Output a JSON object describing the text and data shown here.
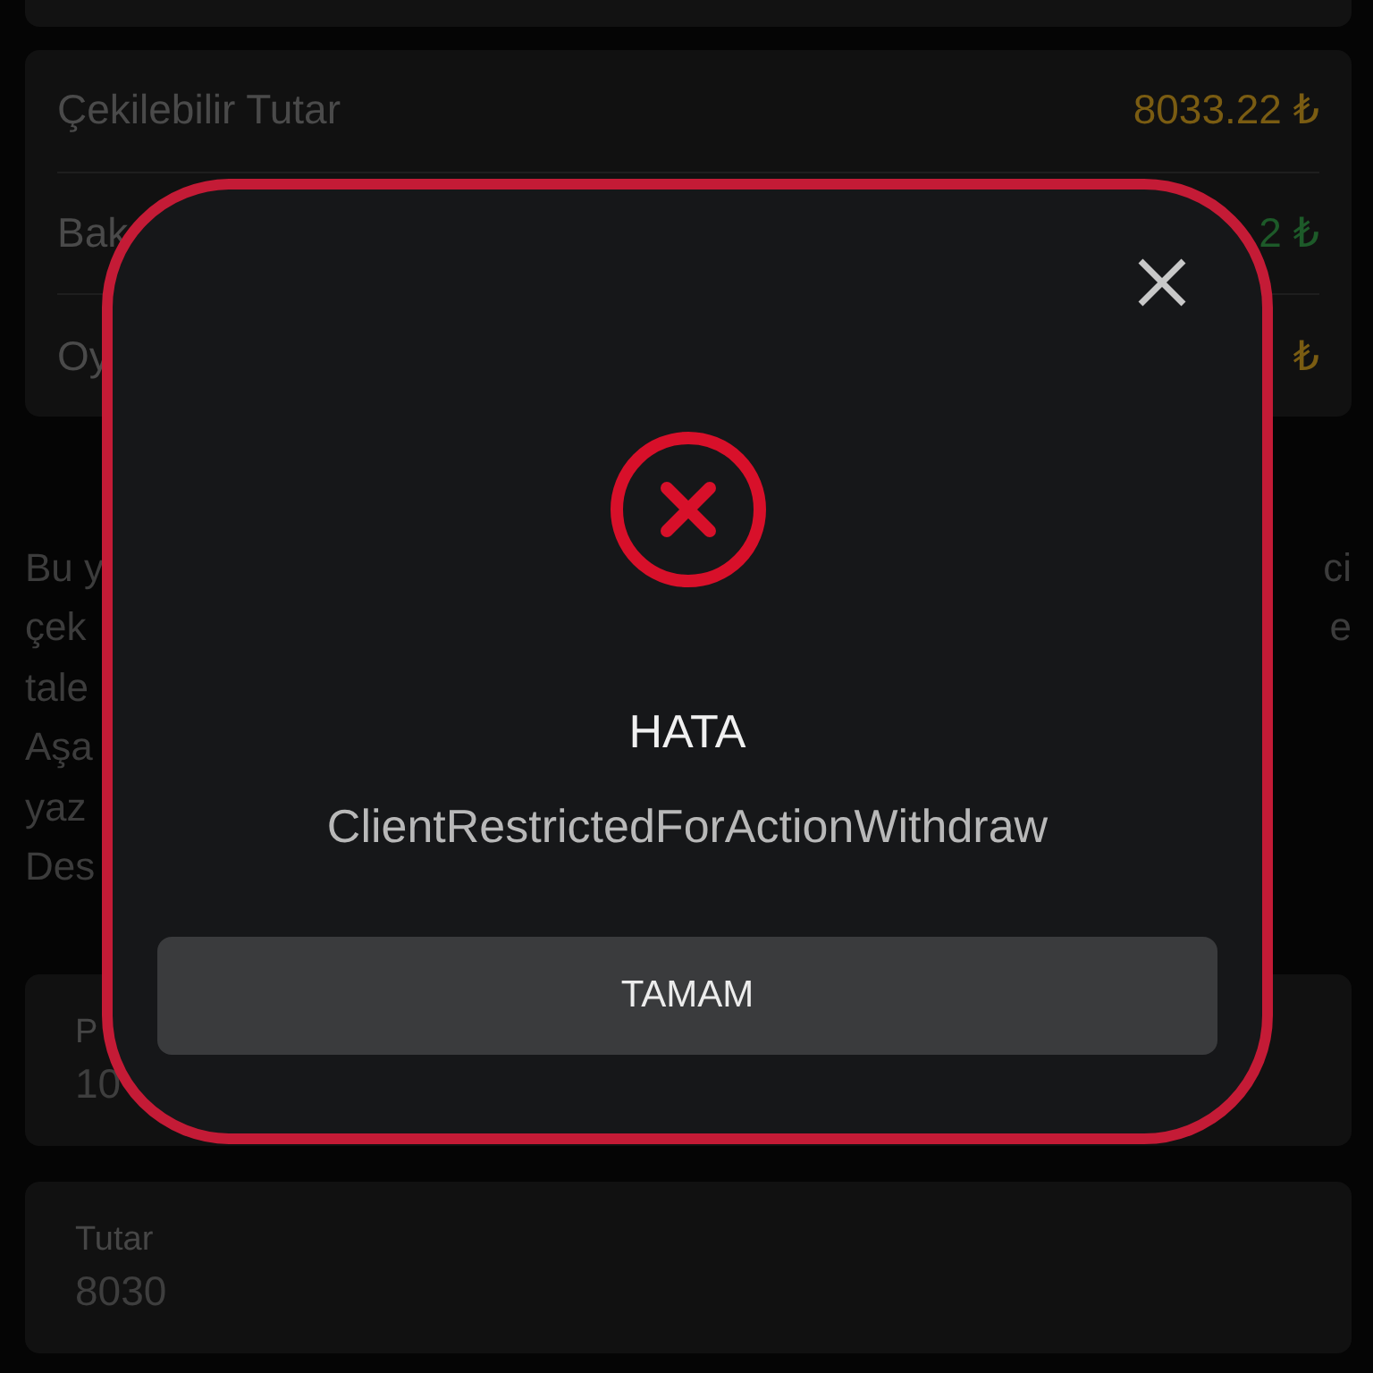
{
  "balances": [
    {
      "label": "Çekilebilir Tutar",
      "value": "8033.22 ₺",
      "color": "#7a5c12"
    },
    {
      "label": "Bak",
      "value": "2 ₺",
      "color": "#1d5a29"
    },
    {
      "label": "Oy",
      "value": "₺",
      "color": "#7a5c12"
    }
  ],
  "notice_lines": [
    {
      "left": "Bu y",
      "right": "ci"
    },
    {
      "left": "çek",
      "right": "e"
    },
    {
      "left": "tale"
    },
    {
      "left": "Aşa"
    },
    {
      "left": "yaz"
    },
    {
      "left": "Des"
    }
  ],
  "fields": [
    {
      "label": "P",
      "value": "10"
    },
    {
      "label": "Tutar",
      "value": "8030"
    }
  ],
  "dialog": {
    "title": "HATA",
    "message": "ClientRestrictedForActionWithdraw",
    "button": "TAMAM"
  }
}
